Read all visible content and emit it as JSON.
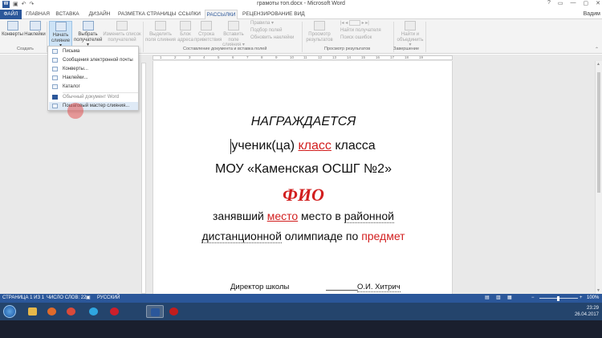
{
  "window": {
    "title": "грамоты топ.docx - Microsoft Word",
    "app_icon": "W",
    "qat": [
      "save-icon",
      "undo-icon",
      "redo-icon"
    ],
    "controls": [
      "?",
      "▭",
      "—",
      "▢",
      "✕"
    ]
  },
  "tabs": {
    "file": "ФАЙЛ",
    "items": [
      "ГЛАВНАЯ",
      "ВСТАВКА",
      "ДИЗАЙН",
      "РАЗМЕТКА СТРАНИЦЫ",
      "ССЫЛКИ",
      "РАССЫЛКИ",
      "РЕЦЕНЗИРОВАНИЕ",
      "ВИД"
    ],
    "active": "РАССЫЛКИ",
    "user": "Вадим"
  },
  "ribbon": {
    "envelopes": "Конверты",
    "labels": "Наклейки",
    "start_merge_1": "Начать",
    "start_merge_2": "слияние ▾",
    "select_recipients_1": "Выбрать",
    "select_recipients_2": "получателей ▾",
    "edit_list_1": "Изменить список",
    "edit_list_2": "получателей",
    "highlight_fields_1": "Выделить",
    "highlight_fields_2": "поля слияния",
    "address_block_1": "Блок",
    "address_block_2": "адреса",
    "greeting_line_1": "Строка",
    "greeting_line_2": "приветствия",
    "insert_field_1": "Вставить поле",
    "insert_field_2": "слияния ▾",
    "rules": "Правила ▾",
    "match_fields": "Подбор полей",
    "update_labels": "Обновить наклейки",
    "preview_1": "Просмотр",
    "preview_2": "результатов",
    "find_recipient": "Найти получателя",
    "check_errors": "Поиск ошибок",
    "finish_1": "Найти и",
    "finish_2": "объединить ▾",
    "groups": {
      "create": "Создать",
      "write_insert": "Составление документа и вставка полей",
      "preview": "Просмотр результатов",
      "finish": "Завершение"
    },
    "nav_arrows": [
      "|◂",
      "◂",
      "▸",
      "▸|"
    ]
  },
  "ruler": [
    "1",
    "2",
    "3",
    "4",
    "5",
    "6",
    "7",
    "8",
    "9",
    "10",
    "11",
    "12",
    "13",
    "14",
    "15",
    "16",
    "17",
    "18",
    "19"
  ],
  "menu": {
    "items": [
      {
        "label": "Письма",
        "dim": false
      },
      {
        "label": "Сообщения электронной почты",
        "dim": false
      },
      {
        "label": "Конверты...",
        "dim": false
      },
      {
        "label": "Наклейки...",
        "dim": false
      },
      {
        "label": "Каталог",
        "dim": false
      },
      {
        "label": "Обычный документ Word",
        "dim": true
      },
      {
        "label": "Пошаговый мастер слияния...",
        "dim": false
      }
    ],
    "hovered": "Пошаговый мастер слияния..."
  },
  "document": {
    "line1": "НАГРАЖДАЕТСЯ",
    "line2_a": "ученик(ца) ",
    "line2_field": "класс",
    "line2_b": " класса",
    "line3": "МОУ «Каменская ОСШГ №2»",
    "line4": "ФИО",
    "line5_a": "занявший ",
    "line5_field": "место",
    "line5_b": " место в ",
    "line5_c": "районной",
    "line6_a": "дистанционной",
    "line6_b": " олимпиаде по ",
    "line6_field": "предмет",
    "sig_left": "Директор  школы",
    "sig_right": "О.И. Хитрич"
  },
  "statusbar": {
    "page": "СТРАНИЦА 1 ИЗ 1",
    "words": "ЧИСЛО СЛОВ: 22",
    "lang": "РУССКИЙ",
    "zoom": "100%"
  },
  "taskbar": {
    "apps": [
      {
        "name": "explorer",
        "color": "#e6b84a",
        "active": false
      },
      {
        "name": "media",
        "color": "#e06a2b",
        "active": false
      },
      {
        "name": "chrome",
        "color": "#d94a3a",
        "active": false
      },
      {
        "name": "skype",
        "color": "#2fa6e0",
        "active": false
      },
      {
        "name": "opera",
        "color": "#cc1f2b",
        "active": false
      },
      {
        "name": "word",
        "color": "#2b579a",
        "active": true
      },
      {
        "name": "recorder",
        "color": "#c21d1d",
        "active": false
      }
    ],
    "time": "23:29",
    "date": "26.04.2017"
  }
}
